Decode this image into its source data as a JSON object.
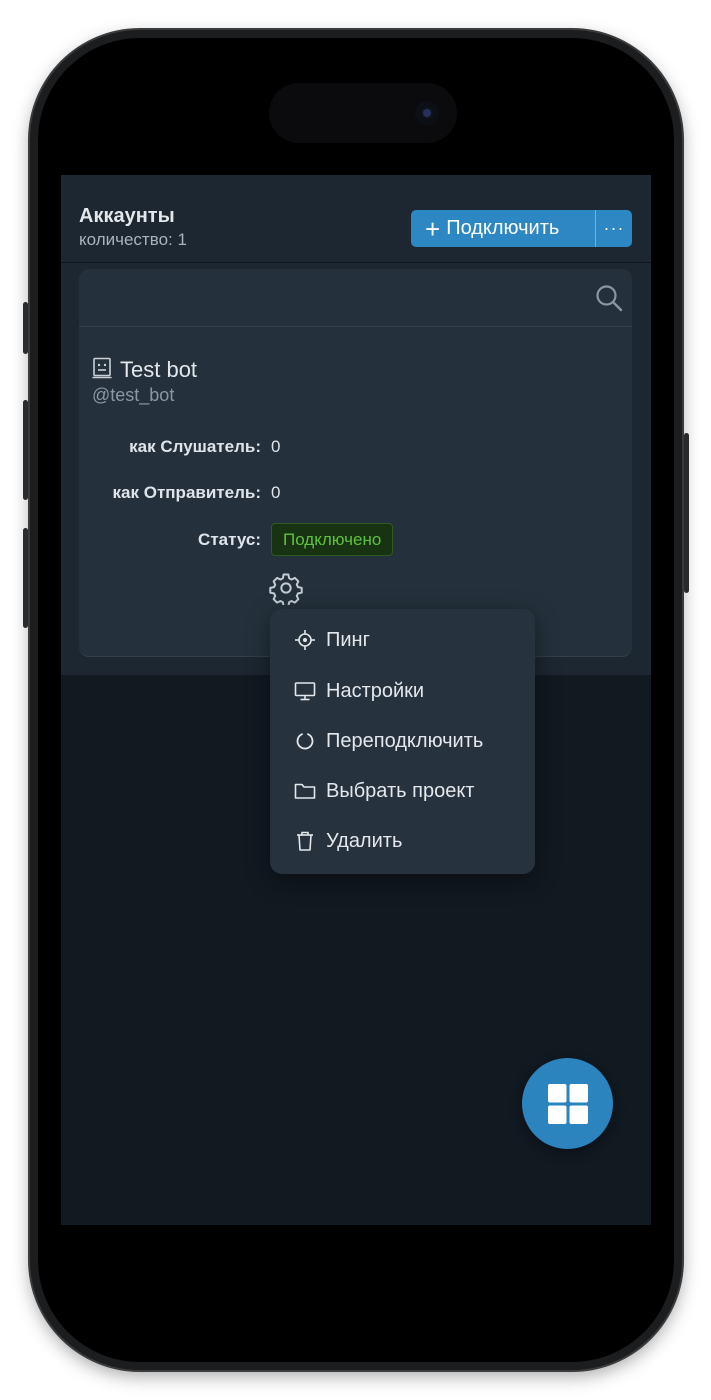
{
  "header": {
    "title": "Аккаунты",
    "subtitle": "количество: 1",
    "connect_label": "Подключить",
    "more_label": "···"
  },
  "search": {
    "placeholder": ""
  },
  "account": {
    "name": "Test bot",
    "handle": "@test_bot",
    "fields": [
      {
        "label": "как Слушатель:",
        "value": "0"
      },
      {
        "label": "как Отправитель:",
        "value": "0"
      }
    ],
    "status_label": "Статус:",
    "status_value": "Подключено"
  },
  "menu": {
    "items": [
      {
        "label": "Пинг",
        "icon": "target-icon"
      },
      {
        "label": "Настройки",
        "icon": "monitor-icon"
      },
      {
        "label": "Переподключить",
        "icon": "reconnect-icon"
      },
      {
        "label": "Выбрать проект",
        "icon": "folder-icon"
      },
      {
        "label": "Удалить",
        "icon": "trash-icon"
      }
    ]
  },
  "colors": {
    "accent": "#2c87c2",
    "status_ok": "#5fc23d",
    "panel": "#1c2731",
    "card": "#24313c",
    "menu": "#26323e"
  }
}
